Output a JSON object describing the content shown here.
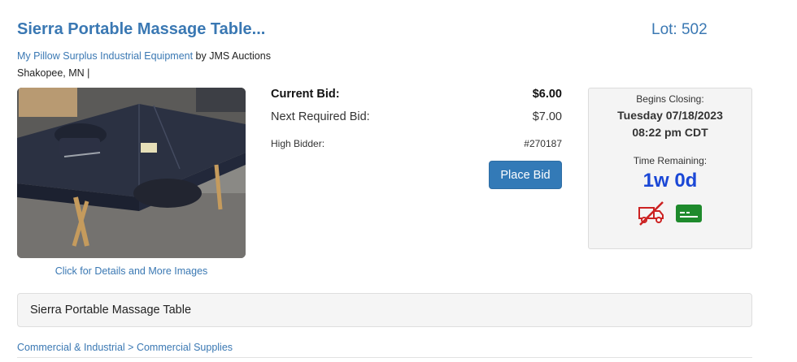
{
  "lot": {
    "title": "Sierra Portable Massage Table...",
    "lot_label": "Lot: 502"
  },
  "seller": {
    "company": "My Pillow Surplus Industrial Equipment",
    "by_text": " by JMS Auctions",
    "location": "Shakopee, MN |"
  },
  "photo": {
    "link_text": "Click for Details and More Images"
  },
  "bidding": {
    "current_bid_label": "Current Bid:",
    "current_bid_value": "$6.00",
    "next_bid_label": "Next Required Bid:",
    "next_bid_value": "$7.00",
    "high_bidder_label": "High Bidder:",
    "high_bidder_value": "#270187",
    "place_bid_label": "Place Bid"
  },
  "closing": {
    "begins_label": "Begins Closing:",
    "date": "Tuesday 07/18/2023",
    "time": "08:22 pm CDT",
    "remaining_label": "Time Remaining:",
    "remaining_value": "1w 0d",
    "icons": [
      "no-shipping-icon",
      "credit-card-icon"
    ],
    "colors": {
      "no_shipping": "#cc2222",
      "card": "#1e8a2c",
      "remaining": "#1a47d6"
    }
  },
  "description": {
    "text": "Sierra Portable Massage Table"
  },
  "category": {
    "parent": "Commercial & Industrial",
    "separator": " > ",
    "child": "Commercial Supplies"
  },
  "colors": {
    "link": "#3a78b3",
    "button": "#337ab7"
  }
}
